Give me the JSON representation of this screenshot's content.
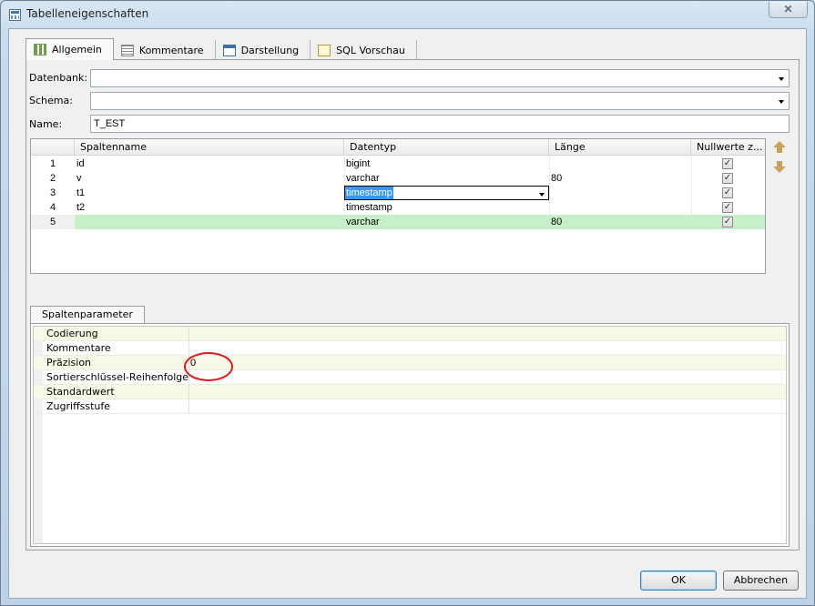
{
  "window": {
    "title": "Tabelleneigenschaften",
    "close_symbol": "✕"
  },
  "tabs": [
    {
      "label": "Allgemein",
      "icon": "grid-table-icon",
      "active": true
    },
    {
      "label": "Kommentare",
      "icon": "document-icon",
      "active": false
    },
    {
      "label": "Darstellung",
      "icon": "form-icon",
      "active": false
    },
    {
      "label": "SQL Vorschau",
      "icon": "sql-preview-icon",
      "active": false
    }
  ],
  "form": {
    "database_label": "Datenbank:",
    "database_value": "",
    "schema_label": "Schema:",
    "schema_value": "",
    "name_label": "Name:",
    "name_value": "T_EST"
  },
  "columns_table": {
    "headers": [
      "Spaltenname",
      "Datentyp",
      "Länge",
      "Nullwerte z..."
    ],
    "rows": [
      {
        "num": "1",
        "name": "id",
        "type": "bigint",
        "length": "",
        "nullable": true
      },
      {
        "num": "2",
        "name": "v",
        "type": "varchar",
        "length": "80",
        "nullable": true
      },
      {
        "num": "3",
        "name": "t1",
        "type": "timestamp",
        "length": "",
        "nullable": true,
        "editing": true
      },
      {
        "num": "4",
        "name": "t2",
        "type": "timestamp",
        "length": "",
        "nullable": true
      },
      {
        "num": "5",
        "name": "",
        "type": "varchar",
        "length": "80",
        "nullable": true,
        "selected": true
      }
    ],
    "check_mark": "✓"
  },
  "side_buttons": {
    "up_icon": "move-up-arrow-icon",
    "down_icon": "move-down-arrow-icon"
  },
  "params": {
    "tab_label": "Spaltenparameter",
    "rows": [
      {
        "name": "Codierung",
        "value": ""
      },
      {
        "name": "Kommentare",
        "value": ""
      },
      {
        "name": "Präzision",
        "value": "0"
      },
      {
        "name": "Sortierschlüssel-Reihenfolge",
        "value": ""
      },
      {
        "name": "Standardwert",
        "value": ""
      },
      {
        "name": "Zugriffsstufe",
        "value": ""
      }
    ]
  },
  "buttons": {
    "ok": "OK",
    "cancel": "Abbrechen"
  },
  "colors": {
    "selected_row": "#c8f0c8",
    "highlight": "#3399ff",
    "annotation": "#e01818"
  }
}
